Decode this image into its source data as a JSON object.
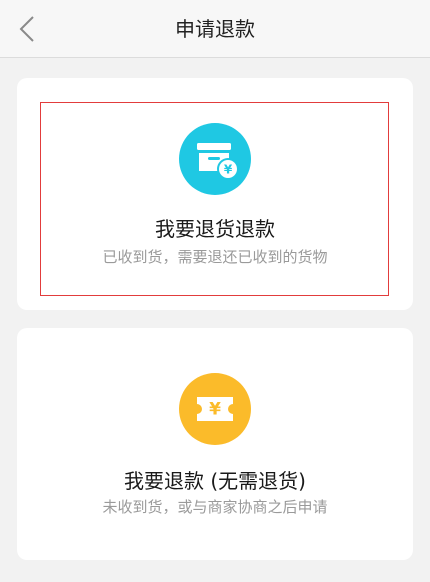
{
  "header": {
    "title": "申请退款",
    "back_icon": "chevron-left-icon"
  },
  "options": [
    {
      "title": "我要退货退款",
      "subtitle": "已收到货，需要退还已收到的货物",
      "icon": "box-with-yen-icon",
      "icon_color": "#1fc8e3",
      "selected": true
    },
    {
      "title": "我要退款 (无需退货)",
      "subtitle": "未收到货，或与商家协商之后申请",
      "icon": "yen-ticket-icon",
      "icon_color": "#fbbb2a",
      "selected": false
    }
  ],
  "colors": {
    "selection_border": "#e23c3c",
    "background": "#f2f2f2"
  }
}
